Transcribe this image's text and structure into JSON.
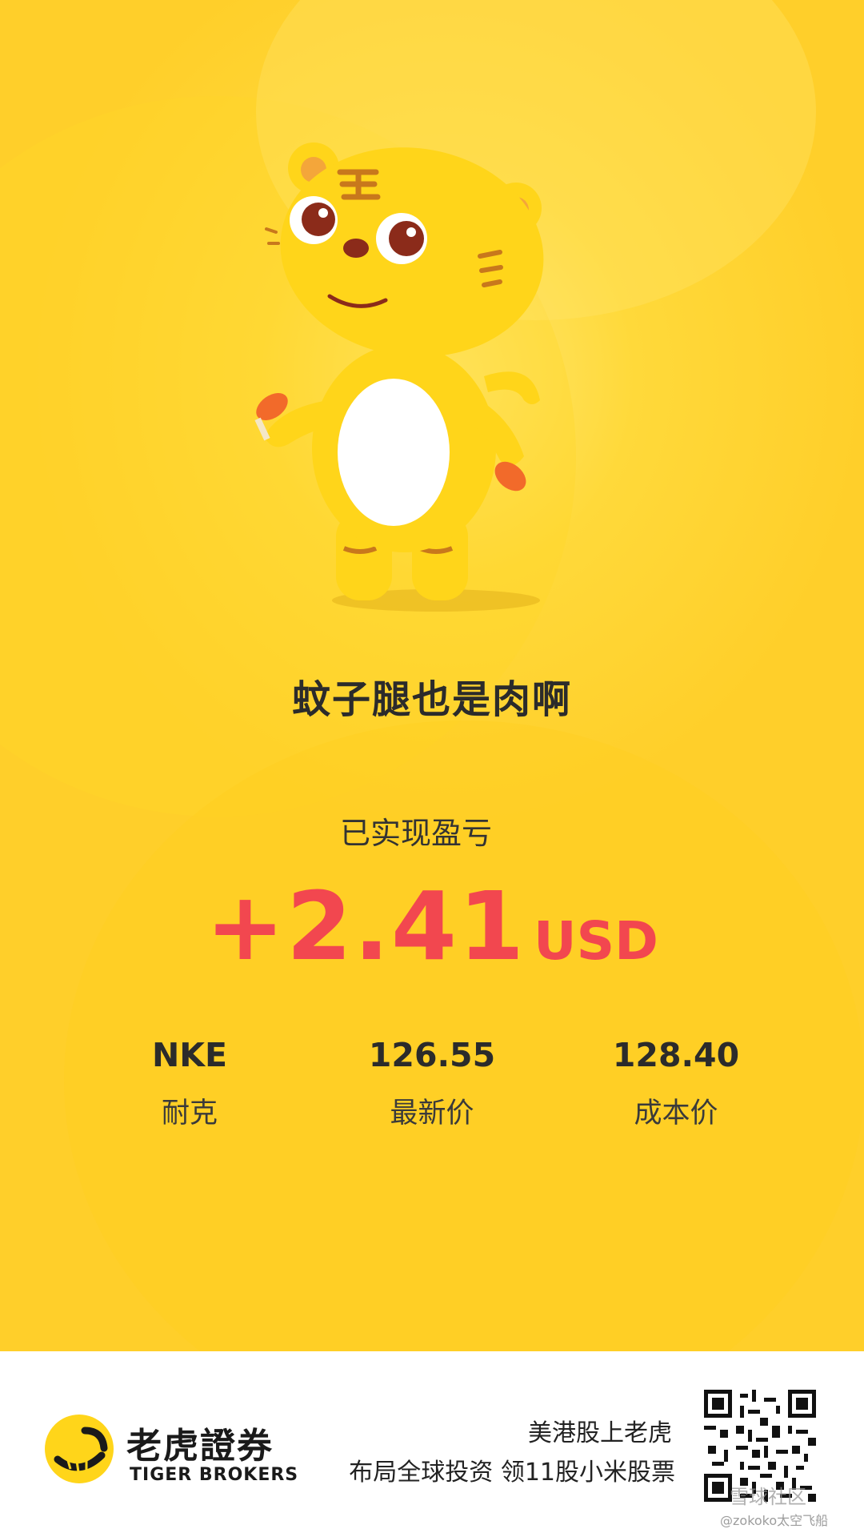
{
  "card": {
    "tagline": "蚊子腿也是肉啊",
    "pnl_label": "已实现盈亏",
    "pnl_value": "+2.41",
    "pnl_currency": "USD"
  },
  "stats": [
    {
      "top": "NKE",
      "bottom": "耐克"
    },
    {
      "top": "126.55",
      "bottom": "最新价"
    },
    {
      "top": "128.40",
      "bottom": "成本价"
    }
  ],
  "footer": {
    "brand_cn": "老虎證券",
    "brand_en": "TIGER BROKERS",
    "promo_line1": "美港股上老虎",
    "promo_line2": "布局全球投资 领11股小米股票",
    "watermark_community": "雪球社区",
    "watermark_user": "@zokoko太空飞船"
  },
  "colors": {
    "background_yellow": "#ffd93a",
    "profit_red": "#f2474f",
    "text_dark": "#2b2b2b"
  },
  "icons": {
    "mascot": "tiger-mascot-icon",
    "logo": "tiger-brokers-logo-icon",
    "qr": "qr-code-icon"
  }
}
